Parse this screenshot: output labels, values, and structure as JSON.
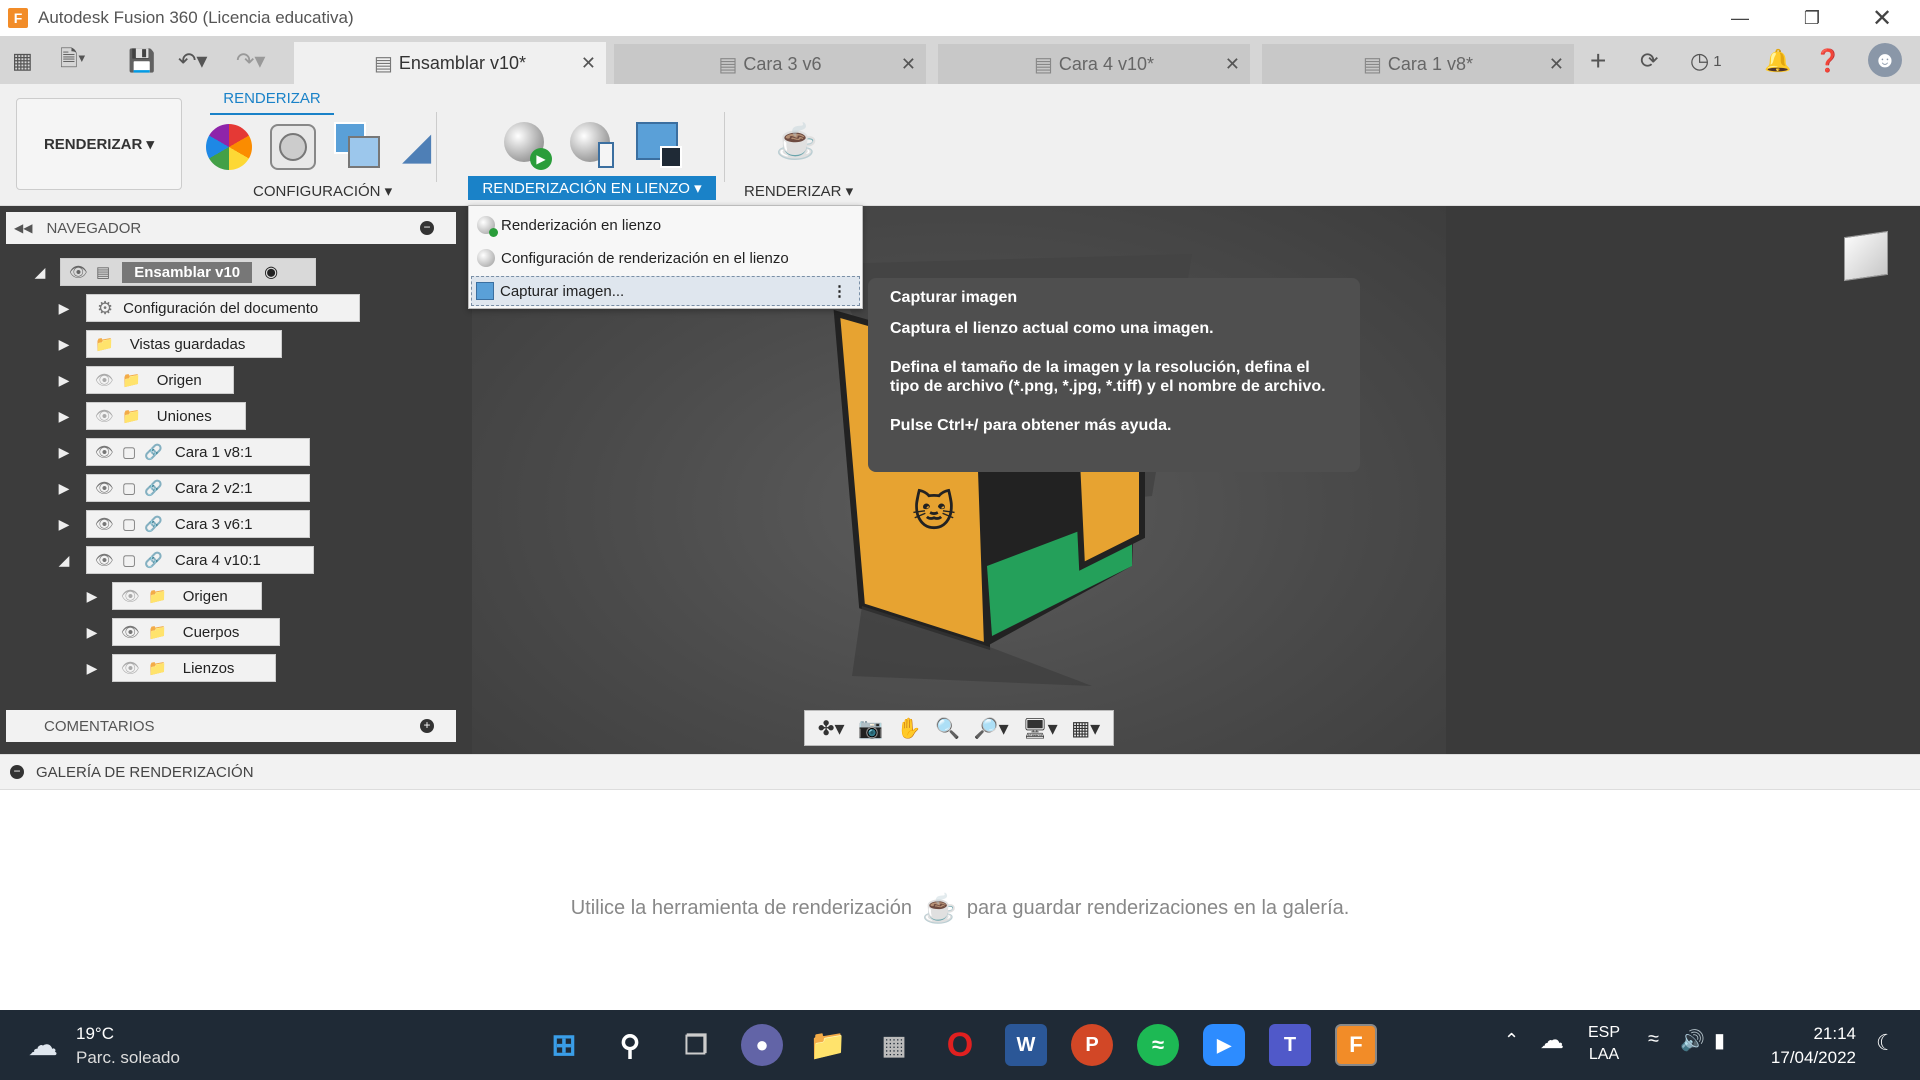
{
  "window": {
    "title": "Autodesk Fusion 360 (Licencia educativa)",
    "app_icon": "F"
  },
  "tabs": [
    {
      "label": "Ensamblar v10*",
      "active": true
    },
    {
      "label": "Cara 3 v6",
      "active": false
    },
    {
      "label": "Cara 4 v10*",
      "active": false
    },
    {
      "label": "Cara 1 v8*",
      "active": false
    }
  ],
  "toolbar": {
    "jobs_count": "1"
  },
  "ribbon": {
    "workspace_label": "RENDERIZAR ▾",
    "active_tab": "RENDERIZAR",
    "groups": {
      "configuracion": "CONFIGURACIÓN ▾",
      "render_lienzo": "RENDERIZACIÓN EN LIENZO ▾",
      "renderizar": "RENDERIZAR ▾"
    }
  },
  "dropdown": {
    "items": [
      "Renderización en lienzo",
      "Configuración de renderización en el lienzo",
      "Capturar imagen..."
    ]
  },
  "tooltip": {
    "title": "Capturar imagen",
    "line1": "Captura el lienzo actual como una imagen.",
    "line2": "Defina el tamaño de la imagen y la resolución, defina el tipo de archivo (*.png, *.jpg, *.tiff) y el nombre de archivo.",
    "line3": "Pulse Ctrl+/ para obtener más ayuda."
  },
  "navigator": {
    "header": "NAVEGADOR",
    "root": "Ensamblar v10",
    "items": [
      "Configuración del documento",
      "Vistas guardadas",
      "Origen",
      "Uniones",
      "Cara 1 v8:1",
      "Cara 2 v2:1",
      "Cara 3 v6:1",
      "Cara 4 v10:1",
      "Origen",
      "Cuerpos",
      "Lienzos"
    ]
  },
  "comments": {
    "header": "COMENTARIOS"
  },
  "gallery": {
    "header": "GALERÍA DE RENDERIZACIÓN",
    "hint_before": "Utilice la herramienta de renderización",
    "hint_after": "para guardar renderizaciones en la galería."
  },
  "taskbar": {
    "weather_temp": "19°C",
    "weather_desc": "Parc. soleado",
    "lang1": "ESP",
    "lang2": "LAA",
    "time": "21:14",
    "date": "17/04/2022"
  }
}
